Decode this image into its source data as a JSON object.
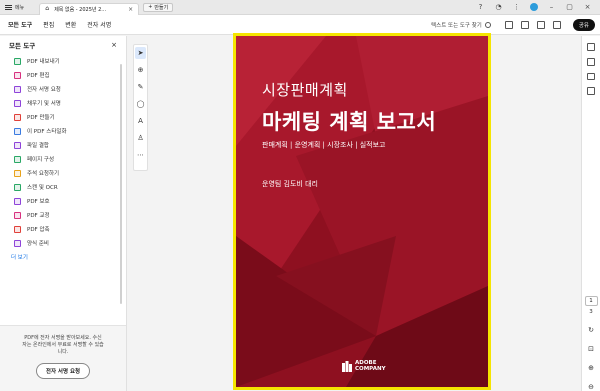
{
  "tabstrip": {
    "menu_label": "메뉴",
    "doc_tab_title": "제목 없음 - 2025년 2...",
    "new_tab_label": "만들기"
  },
  "toolbar": {
    "tabs": [
      {
        "label": "모든 도구",
        "active": true
      },
      {
        "label": "편집",
        "active": false
      },
      {
        "label": "변환",
        "active": false
      },
      {
        "label": "전자 서명",
        "active": false
      }
    ],
    "find_label": "텍스트 또는 도구 찾기",
    "share_label": "공유"
  },
  "left_panel": {
    "title": "모든 도구",
    "tools": [
      {
        "label": "PDF 내보내기",
        "icon": "export-pdf-icon",
        "color": "#2aa866"
      },
      {
        "label": "PDF 편집",
        "icon": "edit-pdf-icon",
        "color": "#d8317f"
      },
      {
        "label": "전자 서명 요청",
        "icon": "request-esign-icon",
        "color": "#8e44d9"
      },
      {
        "label": "채우기 및 서명",
        "icon": "fill-sign-icon",
        "color": "#8e44d9"
      },
      {
        "label": "PDF 만들기",
        "icon": "create-pdf-icon",
        "color": "#e0413a"
      },
      {
        "label": "이 PDF 스타일화",
        "icon": "stylize-pdf-icon",
        "color": "#3b7be0"
      },
      {
        "label": "파일 결합",
        "icon": "combine-files-icon",
        "color": "#8e44d9"
      },
      {
        "label": "페이지 구성",
        "icon": "organize-pages-icon",
        "color": "#2aa866"
      },
      {
        "label": "주석 요청하기",
        "icon": "request-comments-icon",
        "color": "#e8a21b"
      },
      {
        "label": "스캔 및 OCR",
        "icon": "scan-ocr-icon",
        "color": "#2aa866"
      },
      {
        "label": "PDF 보호",
        "icon": "protect-pdf-icon",
        "color": "#8e44d9"
      },
      {
        "label": "PDF 교정",
        "icon": "redact-pdf-icon",
        "color": "#d8317f"
      },
      {
        "label": "PDF 압축",
        "icon": "compress-pdf-icon",
        "color": "#e0413a"
      },
      {
        "label": "양식 준비",
        "icon": "prepare-form-icon",
        "color": "#8e44d9"
      }
    ],
    "more_label": "더 보기",
    "bottom_message": "PDF에 전자 서명을 받아보세요. 수신자는 온라인에서 무료로 서명할 수 있습니다.",
    "sign_button": "전자 서명 요청"
  },
  "document": {
    "title_line1": "시장판매계획",
    "title_line2": "마케팅 계획 보고서",
    "subtitle": "판매계획  |  운영계획  |  시장조사  |  실적보고",
    "author": "운영팀 김도비 대리",
    "logo_line1": "ADOBE",
    "logo_line2": "COMPANY"
  },
  "pagination": {
    "current": "1",
    "total": "3"
  },
  "colors": {
    "cover_dark": "#8e1020",
    "selection_border": "#f5e500",
    "accent_link": "#1473e6"
  }
}
